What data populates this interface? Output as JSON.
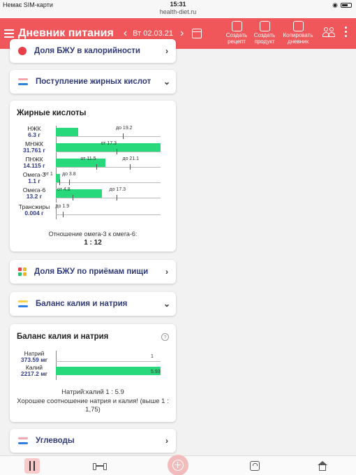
{
  "status": {
    "carrier": "Немає SIM-карти",
    "time": "15:31",
    "url": "health-diet.ru"
  },
  "header": {
    "title": "Дневник питания",
    "date": "Вт 02.03.21",
    "btn_recipe": "Создать рецепт",
    "btn_product": "Создать продукт",
    "btn_copy": "Копировать дневник"
  },
  "accordions": {
    "bju_calories": "Доля БЖУ в калорийности",
    "fatty_intake": "Поступление жирных кислот",
    "bju_meals": "Доля БЖУ по приёмам пищи",
    "kn_balance": "Баланс калия и натрия",
    "carbs": "Углеводы"
  },
  "fatty": {
    "title": "Жирные кислоты",
    "rows": [
      {
        "name": "НЖК",
        "value": "6.3 г",
        "marker_to": "до 19.2"
      },
      {
        "name": "МНЖК",
        "value": "31.761 г",
        "marker_from": "от 17.3"
      },
      {
        "name": "ПНЖК",
        "value": "14.115 г",
        "marker_from": "от 11.5",
        "marker_to": "до 21.1"
      },
      {
        "name": "Омега-3",
        "value": "1.1 г",
        "marker_from": "от 1",
        "marker_to": "до 3.8"
      },
      {
        "name": "Омега-6",
        "value": "13.2 г",
        "marker_from": "от 4.8",
        "marker_to": "до 17.3"
      },
      {
        "name": "Трансжиры",
        "value": "0.004 г",
        "marker_to": "до 1.9"
      }
    ],
    "ratio_label": "Отношение омега-3 к омега-6:",
    "ratio_value": "1 : 12"
  },
  "kn": {
    "title": "Баланс калия и натрия",
    "help": "?",
    "sodium": {
      "name": "Натрий",
      "value": "373.59 мг",
      "scale": "1"
    },
    "potassium": {
      "name": "Калий",
      "value": "2217.2 мг",
      "scale": "5.93"
    },
    "ratio": "Натрий:калий 1 : 5.9",
    "note": "Хорошее соотношение натрия и калия! (выше 1 : 1,75)"
  },
  "chart_data": [
    {
      "type": "bar",
      "title": "Жирные кислоты",
      "categories": [
        "НЖК",
        "МНЖК",
        "ПНЖК",
        "Омега-3",
        "Омега-6",
        "Трансжиры"
      ],
      "values": [
        6.3,
        31.761,
        14.115,
        1.1,
        13.2,
        0.004
      ],
      "unit": "г",
      "ranges": [
        [
          null,
          19.2
        ],
        [
          17.3,
          null
        ],
        [
          11.5,
          21.1
        ],
        [
          1,
          3.8
        ],
        [
          4.8,
          17.3
        ],
        [
          null,
          1.9
        ]
      ]
    },
    {
      "type": "bar",
      "title": "Баланс калия и натрия",
      "categories": [
        "Натрий",
        "Калий"
      ],
      "values": [
        373.59,
        2217.2
      ],
      "unit": "мг",
      "relative": [
        1,
        5.93
      ]
    }
  ],
  "colors": {
    "header": "#f0575a",
    "bar": "#27d97a",
    "value_text": "#2f3a8a"
  }
}
